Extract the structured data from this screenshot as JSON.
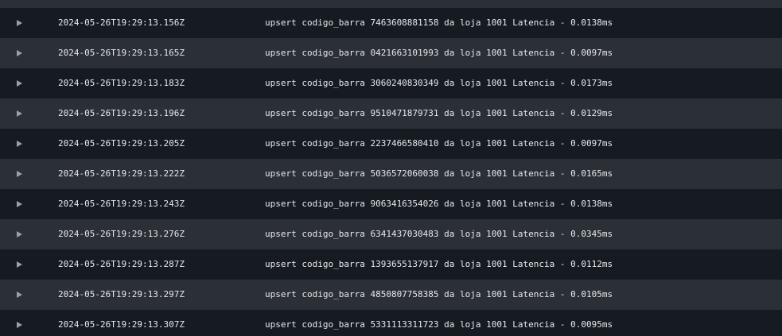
{
  "colors": {
    "row_dark": "#161b22",
    "row_light": "#2b2f36",
    "text": "#e6e9ee",
    "icon": "#9aa0a6"
  },
  "icons": {
    "expand": "caret-right-icon"
  },
  "logs": [
    {
      "timestamp": "2024-05-26T19:29:13.156Z",
      "message": "upsert codigo_barra 7463608881158 da loja 1001 Latencia - 0.0138ms"
    },
    {
      "timestamp": "2024-05-26T19:29:13.165Z",
      "message": "upsert codigo_barra 0421663101993 da loja 1001 Latencia - 0.0097ms"
    },
    {
      "timestamp": "2024-05-26T19:29:13.183Z",
      "message": "upsert codigo_barra 3060240830349 da loja 1001 Latencia - 0.0173ms"
    },
    {
      "timestamp": "2024-05-26T19:29:13.196Z",
      "message": "upsert codigo_barra 9510471879731 da loja 1001 Latencia - 0.0129ms"
    },
    {
      "timestamp": "2024-05-26T19:29:13.205Z",
      "message": "upsert codigo_barra 2237466580410 da loja 1001 Latencia - 0.0097ms"
    },
    {
      "timestamp": "2024-05-26T19:29:13.222Z",
      "message": "upsert codigo_barra 5036572060038 da loja 1001 Latencia - 0.0165ms"
    },
    {
      "timestamp": "2024-05-26T19:29:13.243Z",
      "message": "upsert codigo_barra 9063416354026 da loja 1001 Latencia - 0.0138ms"
    },
    {
      "timestamp": "2024-05-26T19:29:13.276Z",
      "message": "upsert codigo_barra 6341437030483 da loja 1001 Latencia - 0.0345ms"
    },
    {
      "timestamp": "2024-05-26T19:29:13.287Z",
      "message": "upsert codigo_barra 1393655137917 da loja 1001 Latencia - 0.0112ms"
    },
    {
      "timestamp": "2024-05-26T19:29:13.297Z",
      "message": "upsert codigo_barra 4850807758385 da loja 1001 Latencia - 0.0105ms"
    },
    {
      "timestamp": "2024-05-26T19:29:13.307Z",
      "message": "upsert codigo_barra 5331113311723 da loja 1001 Latencia - 0.0095ms"
    }
  ]
}
